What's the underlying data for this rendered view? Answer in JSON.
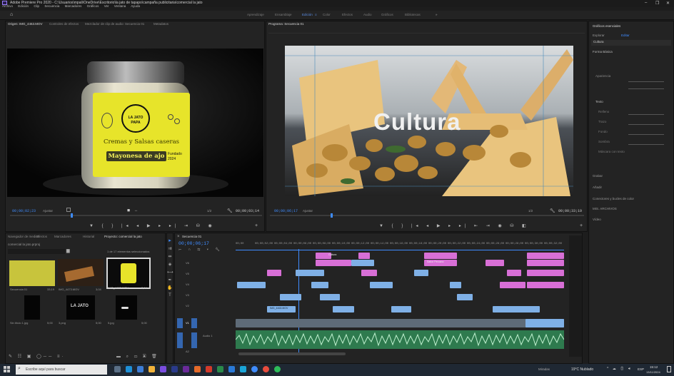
{
  "window": {
    "title": "Adobe Premiere Pro 2020 - C:\\Usuarios\\mpali\\OneDrive\\Escritorio\\la jato de tapapo\\campaña publicitaria\\comercial  la jato",
    "controls": [
      "–",
      "❐",
      "✕"
    ]
  },
  "menu": [
    "Archivo",
    "Edición",
    "Clip",
    "Secuencia",
    "Marcadores",
    "Gráficos",
    "Ver",
    "Ventana",
    "Ayuda"
  ],
  "workspaces": {
    "items": [
      "Aprendizaje",
      "Ensamblaje",
      "Edición",
      "Color",
      "Efectos",
      "Audio",
      "Gráficos",
      "Bibliotecas"
    ],
    "active": "Edición",
    "more": "»"
  },
  "source": {
    "tabs": [
      "Origen: IMG_4463.MOV",
      "Controles de efectos",
      "Mezclador de clip de audio: Secuencia 01",
      "Metadatos"
    ],
    "timecode": "00;00;02;23",
    "fit": "Ajustar",
    "fraction": "1/2",
    "duration": "00;00;03;14",
    "jar": {
      "brand_top": "LA JATO",
      "brand_bottom": "PAPA",
      "tagline": "Cremas y Salsas caseras",
      "product": "Mayonesa de ajo",
      "badge": "Fundado 2024"
    }
  },
  "program": {
    "tab": "Programa: Secuencia 01",
    "overlay_text": "Cultura",
    "timecode": "00;00;06;17",
    "fit": "Ajustar",
    "fraction": "1/2",
    "duration": "00;00;33;19"
  },
  "project": {
    "tabs": [
      "Proyecto: comercial  la jato",
      "Efectos",
      "Marcadores",
      "Historial",
      "Navegador de medios"
    ],
    "file": "comercial  la jato.prproj",
    "count": "1 de 17 elementos seleccionados",
    "items": [
      {
        "name": "Secuencia 01",
        "dur": "33;19"
      },
      {
        "name": "IMG_4473.MOV",
        "dur": "3;04"
      },
      {
        "name": "IMG_4463.MOV",
        "dur": "3;14"
      },
      {
        "name": "Sin título 1.jpg",
        "dur": "5;00"
      },
      {
        "name": "3.png",
        "dur": "5;00"
      },
      {
        "name": "5.jpg",
        "dur": "5;00"
      }
    ]
  },
  "timeline": {
    "tab": "Secuencia 01",
    "timecode": "00;00;06;17",
    "ruler": [
      "00;00",
      "00;00;02;00",
      "00;00;04;00",
      "00;00;06;00",
      "00;00;08;00",
      "00;00;10;00",
      "00;00;12;00",
      "00;00;14;00",
      "00;00;16;00",
      "00;00;18;00",
      "00;00;20;00",
      "00;00;22;00",
      "00;00;24;00",
      "00;00;26;00",
      "00;00;28;00",
      "00;00;30;00",
      "00;00;32;00"
    ],
    "tracks": [
      "V6",
      "V5",
      "V4",
      "V3",
      "V2",
      "V1",
      "A1",
      "A2"
    ],
    "audio_label": "Audio 1",
    "title_clip": "Cultura",
    "sabor_clip": "Sabor Peruano",
    "clip_label": "IMG_4463.MOV"
  },
  "essential_graphics": {
    "header": "Gráficos esenciales",
    "tabs": [
      "Explorar",
      "Editar"
    ],
    "layer": "Cultura",
    "sections": [
      "Forma Básica",
      "Apariencia",
      "Texto",
      "Relleno",
      "Trazo",
      "Fondo",
      "Sombra",
      "Máscara con texto"
    ],
    "panels": [
      "Grabar",
      "Añadir",
      "Conectores y bucles de color",
      "MIS. ARCHIVOS",
      "Vídeo"
    ]
  },
  "taskbar": {
    "search_placeholder": "Escribe aquí para buscar",
    "weather": "19°C  Nublado",
    "lang": "ESP",
    "time": "15:12",
    "date": "13/11/2024",
    "weekday_label": "Miradas"
  },
  "colors": {
    "accent": "#3f8cff",
    "pink_clip": "#d86fd6",
    "blue_clip": "#7fb0e6",
    "green_clip": "#44b072",
    "jar_label": "#e7e42a"
  }
}
